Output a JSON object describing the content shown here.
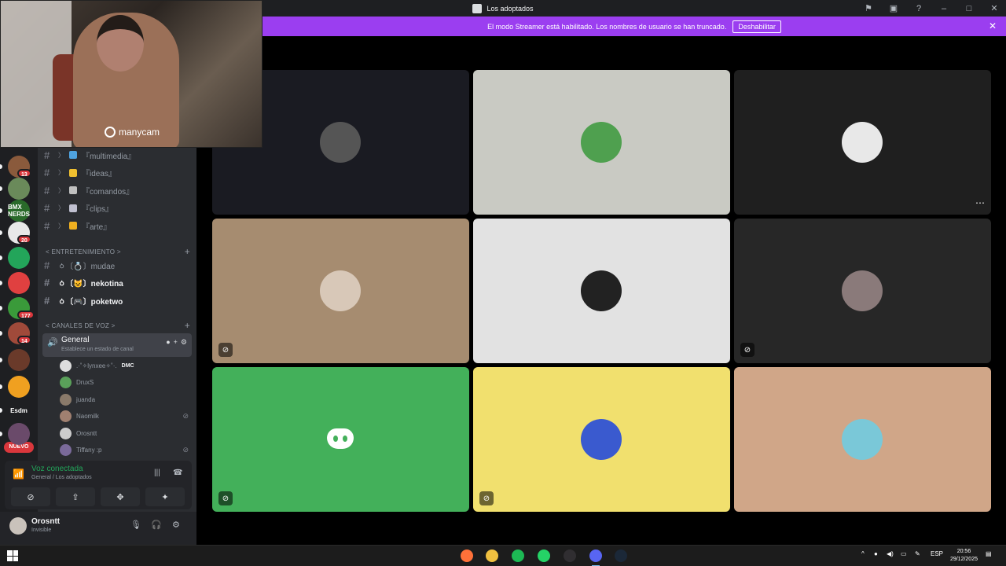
{
  "window": {
    "title": "Los adoptados",
    "actions": [
      "inbox-icon",
      "screen-icon",
      "help-icon",
      "minimize-icon",
      "maximize-icon",
      "close-icon"
    ]
  },
  "banner": {
    "text": "El modo Streamer está habilitado. Los nombres de usuario se han truncado.",
    "button": "Deshabilitar"
  },
  "webcam": {
    "watermark": "manycam"
  },
  "servers": [
    {
      "badge": "13",
      "color": "#8a5a3c"
    },
    {
      "badge": "",
      "color": "#6a8a5a"
    },
    {
      "badge": "",
      "color": "#2a6a2a",
      "text": "BMX NERDS"
    },
    {
      "badge": "20",
      "color": "#e8e8e8"
    },
    {
      "badge": "",
      "color": "#23a55a"
    },
    {
      "badge": "",
      "color": "#e04040"
    },
    {
      "badge": "177",
      "color": "#3a9a3a"
    },
    {
      "badge": "14",
      "color": "#a04a3a"
    },
    {
      "badge": "",
      "color": "#6a3a2a"
    },
    {
      "badge": "",
      "color": "#f0a020"
    },
    {
      "badge": "",
      "color": "#1e1f22",
      "text": "Esdm"
    },
    {
      "badge": "",
      "color": "#6a4a6a"
    }
  ],
  "rail": {
    "new_label": "NUEVO"
  },
  "channels_top": [
    {
      "name": "『multimedia』",
      "color": "#4fa3e0"
    },
    {
      "name": "『ideas』",
      "color": "#f0c030"
    },
    {
      "name": "『comandos』",
      "color": "#c0c0c0"
    },
    {
      "name": "『clips』",
      "color": "#c0c0d0"
    },
    {
      "name": "『arte』",
      "color": "#f0b020"
    }
  ],
  "category_entertainment": "< ENTRETENIMIENTO >",
  "channels_entertainment": [
    {
      "name": "ㆁ〔💍〕mudae",
      "bold": false
    },
    {
      "name": "ㆁ〔😺〕nekotina",
      "bold": true
    },
    {
      "name": "ㆁ〔🎮〕poketwo",
      "bold": true
    }
  ],
  "category_voice": "< CANALES DE VOZ >",
  "voice_channel": {
    "name": "General",
    "status_placeholder": "Establece un estado de canal"
  },
  "voice_users": [
    {
      "name": ".·˚✧lynxee✧˚·.",
      "tag": "DMC",
      "muted": false,
      "color": "#ddd"
    },
    {
      "name": "DruxS",
      "tag": "",
      "muted": false,
      "color": "#5aa05a"
    },
    {
      "name": "juanda",
      "tag": "",
      "muted": false,
      "color": "#8a7a6a"
    },
    {
      "name": "Naomilk",
      "tag": "",
      "muted": true,
      "color": "#a08070"
    },
    {
      "name": "Orosntt",
      "tag": "",
      "muted": false,
      "color": "#ccc"
    },
    {
      "name": "Tiffany :p",
      "tag": "",
      "muted": true,
      "color": "#7a6a9a"
    }
  ],
  "voice_connected": {
    "title": "Voz conectada",
    "location": "General / Los adoptados"
  },
  "user": {
    "name": "Orosntt",
    "status": "Invisible"
  },
  "tiles": [
    {
      "bg": "#1a1b22",
      "avatar": "#555",
      "muted": false,
      "more": false
    },
    {
      "bg": "#c9cac3",
      "avatar": "#4fa04f",
      "muted": false,
      "more": false
    },
    {
      "bg": "#1f1f1f",
      "avatar": "#e8e8e8",
      "muted": false,
      "more": true
    },
    {
      "bg": "#a68c70",
      "avatar": "#d8c8b8",
      "muted": true,
      "more": false
    },
    {
      "bg": "#e2e2e2",
      "avatar": "#222",
      "muted": false,
      "more": false
    },
    {
      "bg": "#272727",
      "avatar": "#8a7a7a",
      "muted": true,
      "more": false
    },
    {
      "bg": "#43b05a",
      "avatar": "",
      "muted": true,
      "more": false
    },
    {
      "bg": "#f1e06e",
      "avatar": "#3a5acf",
      "muted": true,
      "more": false
    },
    {
      "bg": "#d0a688",
      "avatar": "#7ac8d8",
      "muted": false,
      "more": false
    }
  ],
  "taskbar": {
    "apps": [
      "firefox-icon",
      "files-icon",
      "spotify-icon",
      "whatsapp-icon",
      "obs-icon",
      "discord-icon",
      "steam-icon"
    ],
    "lang": "ESP",
    "time": "20:56",
    "date": "29/12/2025"
  }
}
